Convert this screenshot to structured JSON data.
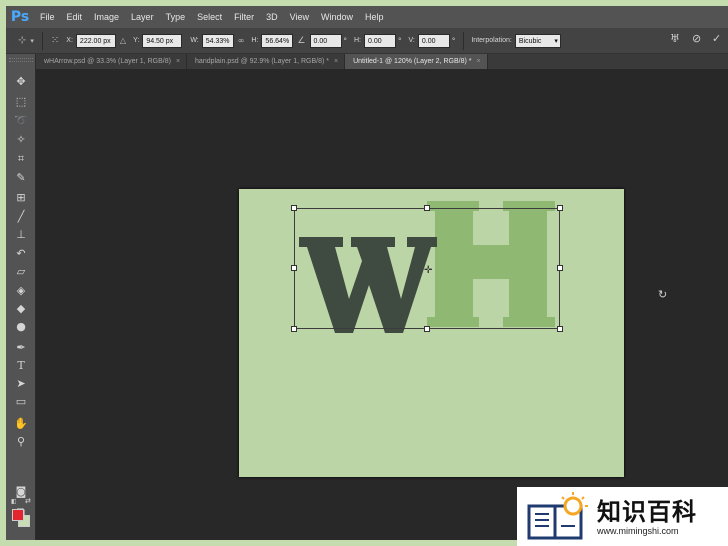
{
  "app": {
    "logo": "Ps",
    "accent": "#4aa8ff"
  },
  "menu": [
    "File",
    "Edit",
    "Image",
    "Layer",
    "Type",
    "Select",
    "Filter",
    "3D",
    "View",
    "Window",
    "Help"
  ],
  "options": {
    "x_label": "X:",
    "x_value": "222.00 px",
    "y_label": "Y:",
    "y_value": "94.50 px",
    "w_label": "W:",
    "w_value": "54.33%",
    "h_label": "H:",
    "h_value": "56.64%",
    "angle_value": "0.00",
    "hskew_label": "H:",
    "hskew_value": "0.00",
    "vskew_label": "V:",
    "vskew_value": "0.00",
    "degree": "°",
    "interpolation_label": "Interpolation:",
    "interpolation_value": "Bicubic"
  },
  "tabs": [
    {
      "label": "wHArrow.psd @ 33.3% (Layer 1, RGB/8)",
      "close": "×"
    },
    {
      "label": "handplain.psd @ 92.9% (Layer 1, RGB/8) *",
      "close": "×"
    },
    {
      "label": "Untitled-1 @ 120% (Layer 2, RGB/8) *",
      "close": "×"
    }
  ],
  "canvas": {
    "letter_w": "w",
    "letter_h": "H",
    "background_color": "#bcd5a6",
    "w_color": "#3f4a40",
    "h_color": "#8fb873"
  },
  "colors": {
    "foreground": "#e2252f",
    "background": "#c8ddb3"
  },
  "watermark": {
    "title": "知识百科",
    "url": "www.mimingshi.com"
  }
}
